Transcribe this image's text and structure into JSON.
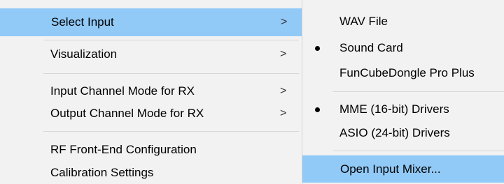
{
  "main_menu": {
    "items": [
      {
        "label": "Select Input",
        "chevron": ">"
      },
      {
        "label": "Visualization",
        "chevron": ">"
      },
      {
        "label": "Input Channel Mode for RX",
        "chevron": ">"
      },
      {
        "label": "Output Channel Mode for RX",
        "chevron": ">"
      },
      {
        "label": "RF Front-End Configuration"
      },
      {
        "label": "Calibration Settings"
      }
    ],
    "highlighted": "Select Input"
  },
  "submenu": {
    "items": [
      {
        "label": "WAV File",
        "checked": false
      },
      {
        "label": "Sound Card",
        "checked": true
      },
      {
        "label": "FunCubeDongle Pro Plus",
        "checked": false
      },
      {
        "label": "MME  (16-bit) Drivers",
        "checked": true
      },
      {
        "label": "ASIO (24-bit) Drivers",
        "checked": false
      },
      {
        "label": "Open Input Mixer...",
        "checked": false
      }
    ],
    "highlighted": "Open Input Mixer..."
  },
  "colors": {
    "menu_background": "#f2f2f2",
    "highlight": "#91c9f7",
    "separator": "#d7d7d7"
  }
}
